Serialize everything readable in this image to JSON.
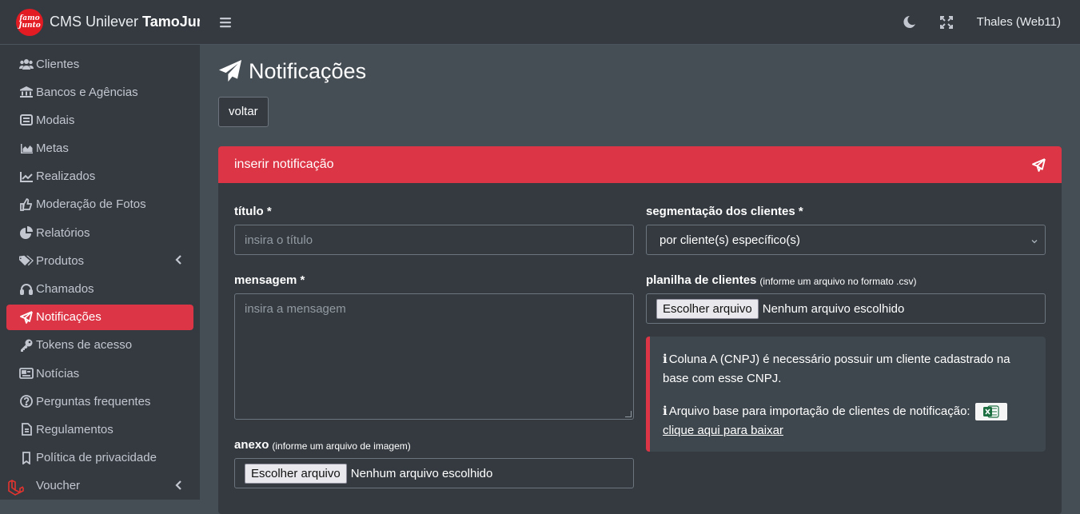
{
  "brand": {
    "logo_top": "famo",
    "logo_bottom": "Junto",
    "prefix": "CMS Unilever",
    "bold": "TamoJun"
  },
  "topbar": {
    "user": "Thales (Web11)"
  },
  "sidebar": {
    "items": [
      {
        "label": "Clientes",
        "icon": "users-icon"
      },
      {
        "label": "Bancos e Agências",
        "icon": "bank-icon"
      },
      {
        "label": "Modais",
        "icon": "modal-icon"
      },
      {
        "label": "Metas",
        "icon": "chart-area-icon"
      },
      {
        "label": "Realizados",
        "icon": "chart-line-icon"
      },
      {
        "label": "Moderação de Fotos",
        "icon": "thumbs-up-icon"
      },
      {
        "label": "Relatórios",
        "icon": "pie-chart-icon"
      },
      {
        "label": "Produtos",
        "icon": "tags-icon"
      },
      {
        "label": "Chamados",
        "icon": "headset-icon"
      },
      {
        "label": "Notificações",
        "icon": "paper-plane-icon"
      },
      {
        "label": "Tokens de acesso",
        "icon": "key-icon"
      },
      {
        "label": "Notícias",
        "icon": "newspaper-icon"
      },
      {
        "label": "Perguntas frequentes",
        "icon": "question-circle-icon"
      },
      {
        "label": "Regulamentos",
        "icon": "file-icon"
      },
      {
        "label": "Política de privacidade",
        "icon": "bookmark-icon"
      },
      {
        "label": "Voucher",
        "icon": "ticket-icon"
      }
    ]
  },
  "page": {
    "title": "Notificações",
    "back_label": "voltar"
  },
  "card": {
    "header": "inserir notificação",
    "titulo_label": "título *",
    "titulo_placeholder": "insira o título",
    "mensagem_label": "mensagem *",
    "mensagem_placeholder": "insira a mensagem",
    "anexo_label": "anexo",
    "anexo_hint": "(informe um arquivo de imagem)",
    "segmentacao_label": "segmentação dos clientes *",
    "segmentacao_value": "por cliente(s) específico(s)",
    "planilha_label": "planilha de clientes",
    "planilha_hint": "(informe um arquivo no formato .csv)",
    "file_button": "Escolher arquivo",
    "file_none": "Nenhum arquivo escolhido",
    "info1": "Coluna A (CNPJ) é necessário possuir um cliente cadastrado na base com esse CNPJ.",
    "info2": "Arquivo base para importação de clientes de notificação:",
    "download_link": "clique aqui para baixar"
  },
  "colors": {
    "accent": "#dc3545",
    "sidebar": "#343a40",
    "content": "#454d55"
  }
}
